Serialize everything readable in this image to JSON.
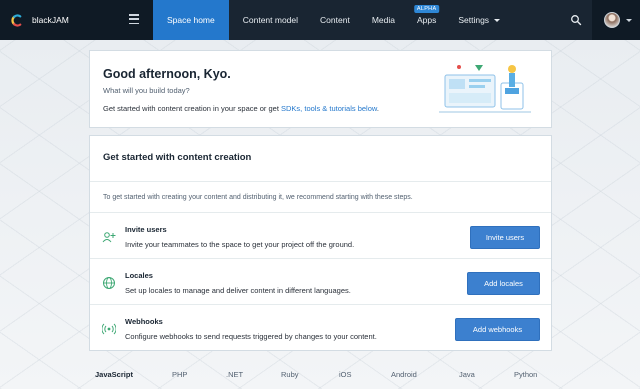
{
  "app": {
    "space_name": "blackJAM"
  },
  "nav": {
    "items": [
      {
        "label": "Space home",
        "active": true
      },
      {
        "label": "Content model"
      },
      {
        "label": "Content"
      },
      {
        "label": "Media"
      },
      {
        "label": "Apps",
        "badge": "ALPHA"
      },
      {
        "label": "Settings",
        "dropdown": true
      }
    ]
  },
  "welcome": {
    "greeting": "Good afternoon, Kyo.",
    "subtitle": "What will you build today?",
    "intro_prefix": "Get started with content creation in your space or get ",
    "intro_link": "SDKs, tools & tutorials below",
    "intro_suffix": "."
  },
  "get_started": {
    "title": "Get started with content creation",
    "description": "To get started with creating your content and distributing it, we recommend starting with these steps.",
    "steps": [
      {
        "title": "Invite users",
        "description": "Invite your teammates to the space to get your project off the ground.",
        "button": "Invite users",
        "icon": "invite-users-icon"
      },
      {
        "title": "Locales",
        "description": "Set up locales to manage and deliver content in different languages.",
        "button": "Add locales",
        "icon": "locales-icon"
      },
      {
        "title": "Webhooks",
        "description": "Configure webhooks to send requests triggered by changes to your content.",
        "button": "Add webhooks",
        "icon": "webhooks-icon"
      }
    ]
  },
  "languages": {
    "items": [
      "JavaScript",
      "PHP",
      ".NET",
      "Ruby",
      "iOS",
      "Android",
      "Java",
      "Python"
    ],
    "active": "JavaScript"
  },
  "colors": {
    "nav_bg": "#192532",
    "accent": "#2478cc",
    "button": "#3c80cf",
    "icon_green": "#3ea874"
  }
}
